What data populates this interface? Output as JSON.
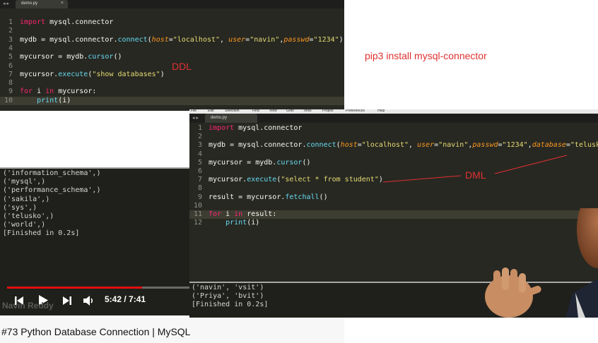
{
  "editor1": {
    "tab_name": "demo.py",
    "tab_close": "×",
    "nav_arrows": "◂ ▸",
    "lines": [
      {
        "n": "1",
        "html": "<span class='k'>import</span> mysql.connector"
      },
      {
        "n": "2",
        "html": ""
      },
      {
        "n": "3",
        "html": "mydb = mysql.connector.<span class='f'>connect</span>(<span class='p'>host</span>=<span class='s'>\"localhost\"</span>, <span class='p'>user</span>=<span class='s'>\"navin\"</span>,<span class='p'>passwd</span>=<span class='s'>\"1234\"</span>)"
      },
      {
        "n": "4",
        "html": ""
      },
      {
        "n": "5",
        "html": "mycursor = mydb.<span class='f'>cursor</span>()"
      },
      {
        "n": "6",
        "html": ""
      },
      {
        "n": "7",
        "html": "mycursor.<span class='f'>execute</span>(<span class='s'>\"show databases\"</span>)"
      },
      {
        "n": "8",
        "html": ""
      },
      {
        "n": "9",
        "html": "<span class='k'>for</span> i <span class='k'>in</span> mycursor:"
      },
      {
        "n": "10",
        "html": "    <span class='f'>print</span>(i)"
      }
    ]
  },
  "terminal1": {
    "output": "('information_schema',)\n('mysql',)\n('performance_schema',)\n('sakila',)\n('sys',)\n('telusko',)\n('world',)\n[Finished in 0.2s]"
  },
  "editor2": {
    "tab_name": "demo.py",
    "nav_arrows": "◂ ▸",
    "menu_items": [
      "File",
      "Edit",
      "Selection",
      "Find",
      "View",
      "Goto",
      "Tools",
      "Project",
      "Preferences",
      "Help"
    ],
    "lines": [
      {
        "n": "1",
        "html": "<span class='k'>import</span> mysql.connector"
      },
      {
        "n": "2",
        "html": ""
      },
      {
        "n": "3",
        "html": "mydb = mysql.connector.<span class='f'>connect</span>(<span class='p'>host</span>=<span class='s'>\"localhost\"</span>, <span class='p'>user</span>=<span class='s'>\"navin\"</span>,<span class='p'>passwd</span>=<span class='s'>\"1234\"</span>,<span class='p'>database</span>=<span class='s'>\"telusko\"</span>)"
      },
      {
        "n": "4",
        "html": ""
      },
      {
        "n": "5",
        "html": "mycursor = mydb.<span class='f'>cursor</span>()"
      },
      {
        "n": "6",
        "html": ""
      },
      {
        "n": "7",
        "html": "mycursor.<span class='f'>execute</span>(<span class='s'>\"select * from student\"</span>)"
      },
      {
        "n": "8",
        "html": ""
      },
      {
        "n": "9",
        "html": "result = mycursor.<span class='f'>fetchall</span>()"
      },
      {
        "n": "10",
        "html": ""
      },
      {
        "n": "11",
        "html": "<span class='k'>for</span> i <span class='k'>in</span> result:"
      },
      {
        "n": "12",
        "html": "    <span class='f'>print</span>(i)"
      }
    ]
  },
  "terminal2": {
    "output": "('navin', 'vsit')\n('Priya', 'bvit')\n[Finished in 0.2s]"
  },
  "player": {
    "time": "5:42 / 7:41",
    "progress": 0.7419,
    "watermark": "Navin Reddy"
  },
  "annotations": {
    "ddl": "DDL",
    "pip": "pip3 install mysql-connector",
    "dml": "DML"
  },
  "video_title": "#73 Python Database Connection | MySQL",
  "colors": {
    "editor_bg": "#272822",
    "keyword": "#f92672",
    "string": "#e6db74",
    "function": "#66d9ef",
    "param": "#fd971f",
    "annotation_red": "#e03030",
    "progress_red": "#e01010"
  }
}
